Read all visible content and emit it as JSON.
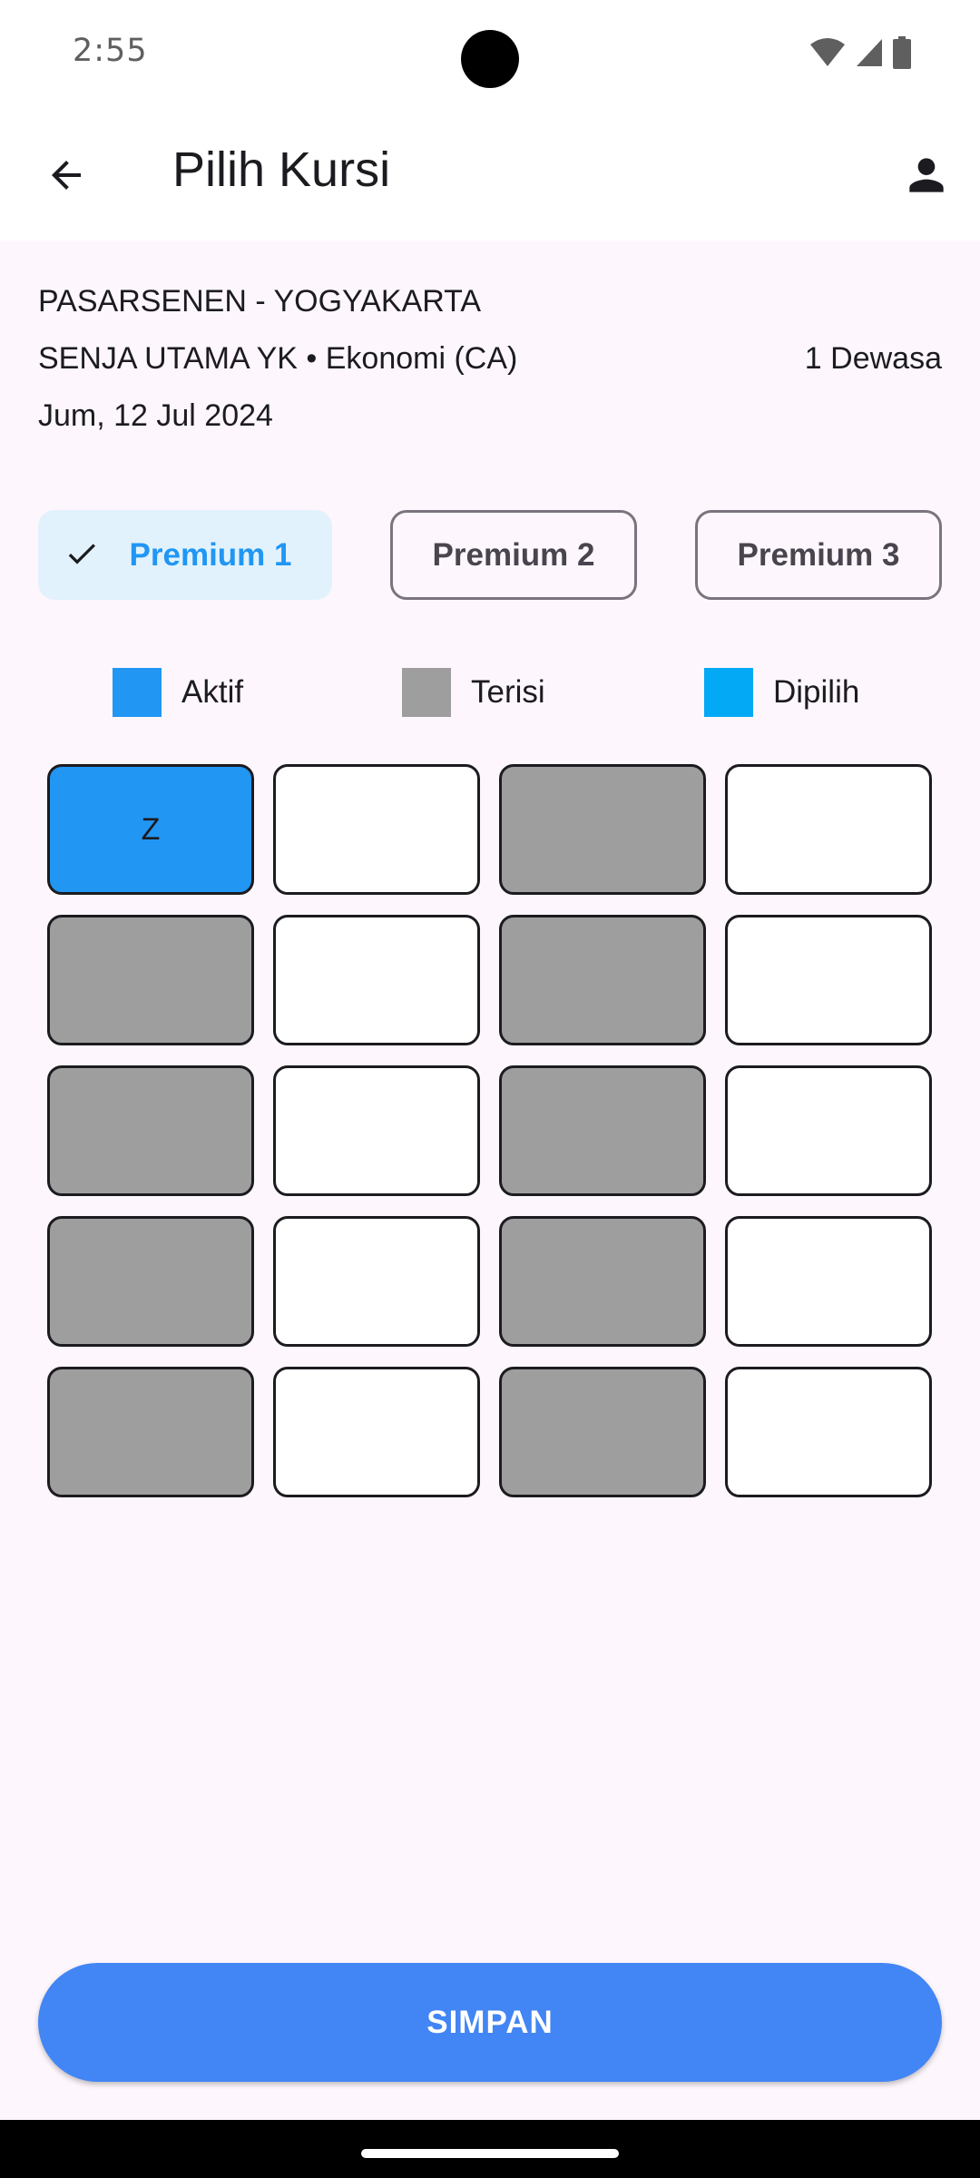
{
  "status_bar": {
    "time": "2:55",
    "icons": [
      "wifi-icon",
      "signal-icon",
      "battery-icon"
    ]
  },
  "app_bar": {
    "title": "Pilih Kursi",
    "back_icon": "arrow-back-icon",
    "profile_icon": "person-icon"
  },
  "trip": {
    "route": "PASARSENEN - YOGYAKARTA",
    "train": "SENJA UTAMA YK • Ekonomi (CA)",
    "passengers": "1 Dewasa",
    "date": "Jum, 12 Jul 2024"
  },
  "classes": [
    {
      "label": "Premium 1",
      "selected": true
    },
    {
      "label": "Premium 2",
      "selected": false
    },
    {
      "label": "Premium 3",
      "selected": false
    }
  ],
  "legend": [
    {
      "label": "Aktif",
      "color": "#2196f3"
    },
    {
      "label": "Terisi",
      "color": "#9e9e9e"
    },
    {
      "label": "Dipilih",
      "color": "#03a9f4"
    }
  ],
  "seats": [
    [
      {
        "label": "Z",
        "state": "active"
      },
      {
        "label": "",
        "state": "available"
      },
      {
        "label": "",
        "state": "filled"
      },
      {
        "label": "",
        "state": "available"
      }
    ],
    [
      {
        "label": "",
        "state": "filled"
      },
      {
        "label": "",
        "state": "available"
      },
      {
        "label": "",
        "state": "filled"
      },
      {
        "label": "",
        "state": "available"
      }
    ],
    [
      {
        "label": "",
        "state": "filled"
      },
      {
        "label": "",
        "state": "available"
      },
      {
        "label": "",
        "state": "filled"
      },
      {
        "label": "",
        "state": "available"
      }
    ],
    [
      {
        "label": "",
        "state": "filled"
      },
      {
        "label": "",
        "state": "available"
      },
      {
        "label": "",
        "state": "filled"
      },
      {
        "label": "",
        "state": "available"
      }
    ],
    [
      {
        "label": "",
        "state": "filled"
      },
      {
        "label": "",
        "state": "available"
      },
      {
        "label": "",
        "state": "filled"
      },
      {
        "label": "",
        "state": "available"
      }
    ]
  ],
  "save_button": {
    "label": "SIMPAN"
  },
  "colors": {
    "accent": "#2196f3",
    "button": "#4285f4",
    "background": "#fdf7fd"
  }
}
